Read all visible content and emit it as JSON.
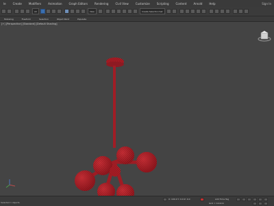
{
  "menu": {
    "items": [
      "le",
      "Create",
      "Modifiers",
      "Animation",
      "Graph Editors",
      "Rendering",
      "Civil View",
      "Customize",
      "Scripting",
      "Content",
      "Arnold",
      "Help"
    ],
    "right_text": "Sign In"
  },
  "toolbar": {
    "all_filter": "All",
    "view_dropdown": "View",
    "selection_set": "Create Selection Set"
  },
  "subbar": {
    "items": [
      "Modeling",
      "Freeform",
      "Selection",
      "Object Paint",
      "Populate"
    ]
  },
  "viewport": {
    "label": "[+] [Perspective] [Standard] [Default Shading]"
  },
  "status": {
    "prompt": "Selected 1 objects",
    "coords": "X: 100.0  Y: 0.0  Z: 0.0",
    "grid": "Grid = 10.0cm",
    "add_time_tag": "Add Time Tag"
  },
  "colors": {
    "object": "#b31f28",
    "viewport_bg": "#444444"
  }
}
